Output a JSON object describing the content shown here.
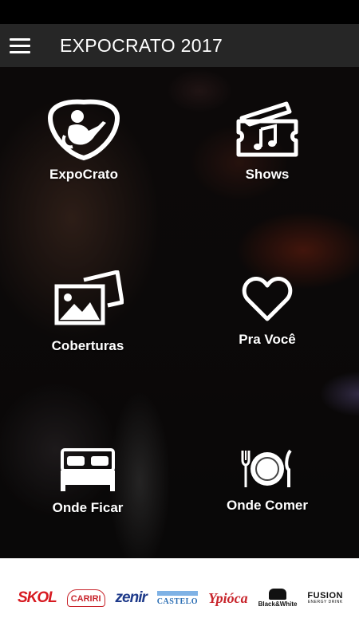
{
  "app_bar": {
    "title": "EXPOCRATO 2017",
    "menu_icon": "hamburger-menu-icon"
  },
  "menu": {
    "expocrato": {
      "label": "ExpoCrato",
      "icon": "guitar-player-icon"
    },
    "shows": {
      "label": "Shows",
      "icon": "music-ticket-icon"
    },
    "coberturas": {
      "label": "Coberturas",
      "icon": "photos-icon"
    },
    "pra_voce": {
      "label": "Pra Você",
      "icon": "heart-icon"
    },
    "onde_ficar": {
      "label": "Onde Ficar",
      "icon": "bed-icon"
    },
    "onde_comer": {
      "label": "Onde Comer",
      "icon": "fork-plate-knife-icon"
    }
  },
  "sponsors": {
    "skol": "SKOL",
    "cariri": "CARIRI",
    "zenir": "zenir",
    "castelo": "CASTELO",
    "ypioca": "Ypióca",
    "black_white": "Black&White",
    "fusion": "FUSION",
    "fusion_sub": "ENERGY DRINK"
  },
  "colors": {
    "app_bar": "#262626",
    "text": "#ffffff",
    "sponsor_bg": "#ffffff"
  }
}
